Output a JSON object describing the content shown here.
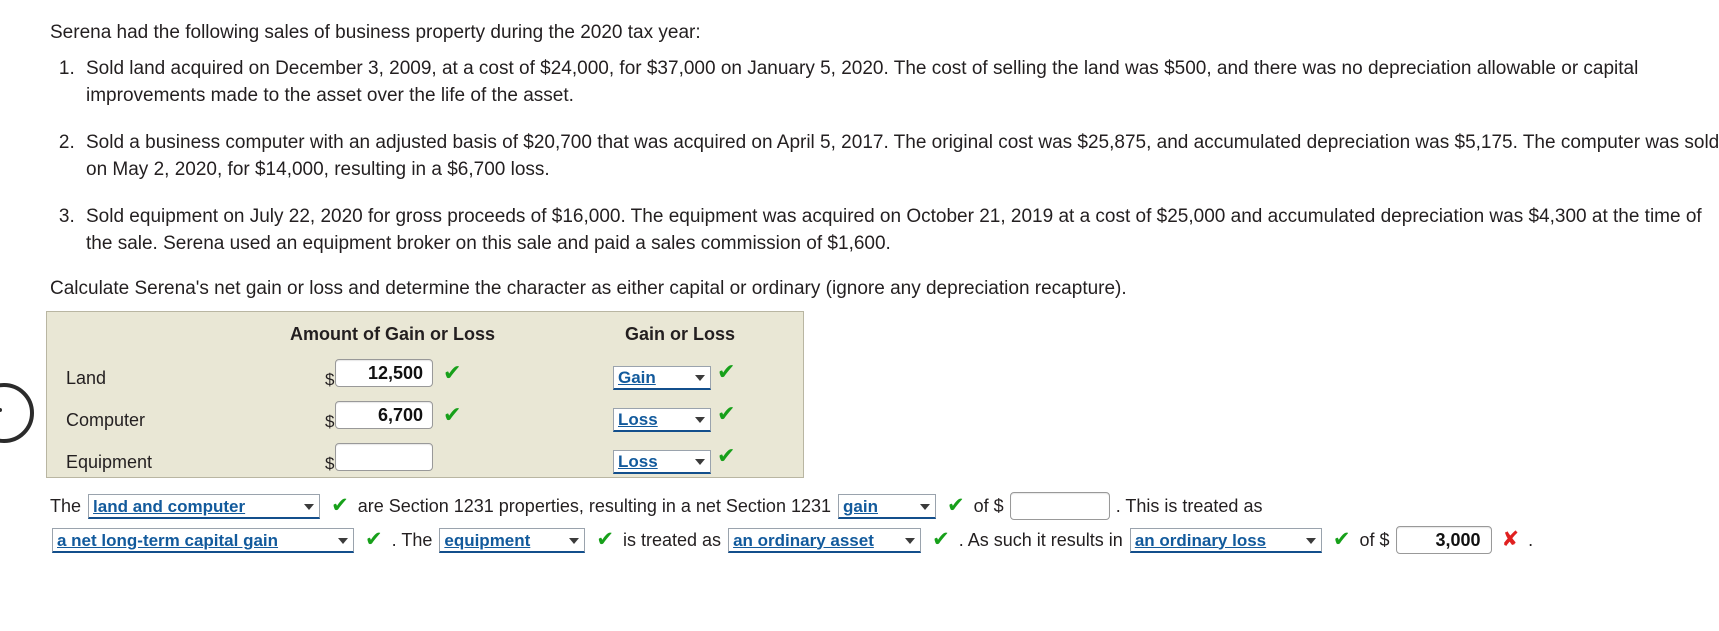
{
  "intro": "Serena had the following sales of business property during the 2020 tax year:",
  "facts": [
    "Sold land acquired on December 3, 2009, at a cost of $24,000, for $37,000 on January 5, 2020. The cost of selling the land was $500, and there was no depreciation allowable or capital improvements made to the asset over the life of the asset.",
    "Sold a business computer with an adjusted basis of $20,700 that was acquired on April 5, 2017. The original cost was $25,875, and accumulated depreciation was $5,175. The computer was sold on May 2, 2020, for $14,000, resulting in a $6,700 loss.",
    "Sold equipment on July 22, 2020 for gross proceeds of $16,000. The equipment was acquired on October 21, 2019 at a cost of $25,000 and accumulated depreciation was $4,300 at the time of the sale. Serena used an equipment broker on this sale and paid a sales commission of $1,600."
  ],
  "calc_instruction": "Calculate Serena's net gain or loss and determine the character as either capital or ordinary (ignore any depreciation recapture).",
  "table": {
    "headers": {
      "amount": "Amount of Gain or Loss",
      "gain_or_loss": "Gain or Loss"
    },
    "currency_symbol": "$",
    "rows": [
      {
        "label": "Land",
        "amount": "12,500",
        "amount_status": "correct",
        "select_value": "Gain",
        "select_status": "correct"
      },
      {
        "label": "Computer",
        "amount": "6,700",
        "amount_status": "correct",
        "select_value": "Loss",
        "select_status": "correct"
      },
      {
        "label": "Equipment",
        "amount": "",
        "amount_status": "none",
        "select_value": "Loss",
        "select_status": "correct"
      }
    ]
  },
  "conclusion": {
    "line1": {
      "t1": "The",
      "sel1": "land and computer",
      "check1": "✔",
      "t2": "are Section 1231 properties, resulting in a net Section 1231",
      "sel2": "gain",
      "check2": "✔",
      "t3": "of $",
      "amount1": "",
      "t4": ". This is treated as"
    },
    "line2": {
      "sel3": "a net long-term capital gain",
      "check3": "✔",
      "t5": ". The",
      "sel4": "equipment",
      "check4": "✔",
      "t6": "is treated as",
      "sel5": "an ordinary asset",
      "check5": "✔",
      "t7": ". As such it results in",
      "sel6": "an ordinary loss",
      "check6": "✔",
      "t8": "of $",
      "amount2": "3,000",
      "cross1": "✘",
      "t9": "."
    }
  },
  "colors": {
    "table_background": "#e9e7d5",
    "correct_check": "#17a01a",
    "incorrect_cross": "#e02020",
    "select_text": "#125a9c"
  }
}
